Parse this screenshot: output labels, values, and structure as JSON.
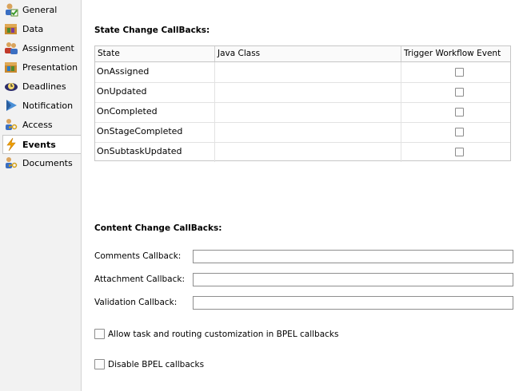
{
  "sidebar": {
    "items": [
      {
        "label": "General",
        "icon": "general-icon"
      },
      {
        "label": "Data",
        "icon": "data-icon"
      },
      {
        "label": "Assignment",
        "icon": "assignment-icon"
      },
      {
        "label": "Presentation",
        "icon": "presentation-icon"
      },
      {
        "label": "Deadlines",
        "icon": "deadlines-icon"
      },
      {
        "label": "Notification",
        "icon": "notification-icon"
      },
      {
        "label": "Access",
        "icon": "access-icon"
      },
      {
        "label": "Events",
        "icon": "events-icon",
        "selected": true
      },
      {
        "label": "Documents",
        "icon": "documents-icon"
      }
    ]
  },
  "state_section": {
    "title": "State Change CallBacks:",
    "columns": [
      "State",
      "Java Class",
      "Trigger Workflow Event"
    ],
    "rows": [
      {
        "state": "OnAssigned",
        "java_class": "",
        "trigger": false
      },
      {
        "state": "OnUpdated",
        "java_class": "",
        "trigger": false
      },
      {
        "state": "OnCompleted",
        "java_class": "",
        "trigger": false
      },
      {
        "state": "OnStageCompleted",
        "java_class": "",
        "trigger": false
      },
      {
        "state": "OnSubtaskUpdated",
        "java_class": "",
        "trigger": false
      }
    ]
  },
  "content_section": {
    "title": "Content Change CallBacks:",
    "fields": [
      {
        "label": "Comments Callback:",
        "value": ""
      },
      {
        "label": "Attachment Callback:",
        "value": ""
      },
      {
        "label": "Validation Callback:",
        "value": ""
      }
    ]
  },
  "options": [
    {
      "label": "Allow task and routing customization in BPEL callbacks",
      "checked": false
    },
    {
      "label": "Disable BPEL callbacks",
      "checked": false
    }
  ],
  "colors": {
    "accent": "#f0a000",
    "border": "#c6c6c6",
    "sidebar_bg": "#f2f2f2"
  }
}
